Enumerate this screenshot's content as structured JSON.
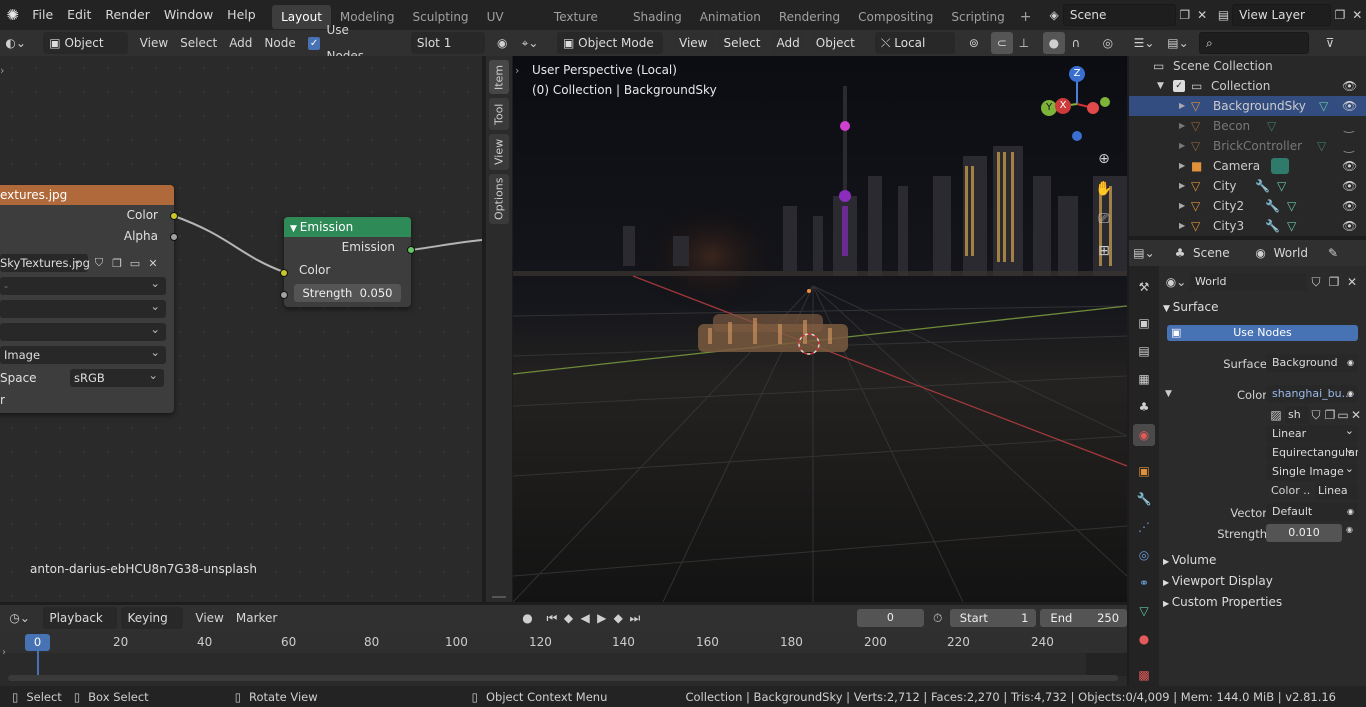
{
  "topbar": {
    "menus": [
      "File",
      "Edit",
      "Render",
      "Window",
      "Help"
    ],
    "workspaces": [
      "Layout",
      "Modeling",
      "Sculpting",
      "UV Editing",
      "Texture Paint",
      "Shading",
      "Animation",
      "Rendering",
      "Compositing",
      "Scripting"
    ],
    "active_workspace": "Layout",
    "add_tab": "+",
    "scene": "Scene",
    "view_layer": "View Layer"
  },
  "node_editor": {
    "header": {
      "object_mode": "Object",
      "menus": [
        "View",
        "Select",
        "Add",
        "Node"
      ],
      "use_nodes_label": "Use Nodes",
      "use_nodes_checked": true,
      "slot": "Slot 1"
    },
    "image_node": {
      "title": "extures.jpg",
      "out_color": "Color",
      "out_alpha": "Alpha",
      "image_name": "SkyTextures.jpg",
      "source": "Image",
      "color_space_label": "Space",
      "color_space": "sRGB",
      "trailing": "r"
    },
    "emission_node": {
      "title": "Emission",
      "out_emission": "Emission",
      "in_color": "Color",
      "strength_label": "Strength",
      "strength_value": "0.050"
    },
    "frame_label": "anton-darius-ebHCU8n7G38-unsplash",
    "side_tabs": [
      "Item",
      "Tool",
      "View",
      "Options"
    ]
  },
  "viewport": {
    "header": {
      "mode": "Object Mode",
      "menus": [
        "View",
        "Select",
        "Add",
        "Object"
      ],
      "orientation": "Local"
    },
    "overlay_title": "User Perspective (Local)",
    "overlay_sub": "(0) Collection | BackgroundSky",
    "gizmo": {
      "x": "X",
      "y": "Y",
      "z": "Z"
    }
  },
  "outliner": {
    "root": "Scene Collection",
    "collection": "Collection",
    "items": [
      {
        "name": "BackgroundSky",
        "dim": false
      },
      {
        "name": "Becon",
        "dim": true
      },
      {
        "name": "BrickController",
        "dim": true
      },
      {
        "name": "Camera",
        "dim": false
      },
      {
        "name": "City",
        "dim": false
      },
      {
        "name": "City2",
        "dim": false
      },
      {
        "name": "City3",
        "dim": false
      }
    ]
  },
  "properties": {
    "header": {
      "scene_tab": "Scene",
      "world_tab": "World"
    },
    "world_name": "World",
    "surface_section": "Surface",
    "use_nodes_btn": "Use Nodes",
    "surface_label": "Surface",
    "surface_value": "Background",
    "color_label": "Color",
    "color_value": "shanghai_bu...",
    "image_short": "sh",
    "interpolation": "Linear",
    "projection": "Equirectangular",
    "source": "Single Image",
    "colorspace_label": "Color ..",
    "colorspace_value": "Linea",
    "vector_label": "Vector",
    "vector_value": "Default",
    "strength_label": "Strength",
    "strength_value": "0.010",
    "collapsed": [
      "Volume",
      "Viewport Display",
      "Custom Properties"
    ]
  },
  "timeline": {
    "header": {
      "menus": [
        "Playback",
        "Keying",
        "View",
        "Marker"
      ],
      "current_frame": "0",
      "start_label": "Start",
      "start": "1",
      "end_label": "End",
      "end": "250"
    },
    "ticks": [
      "0",
      "20",
      "40",
      "60",
      "80",
      "100",
      "120",
      "140",
      "160",
      "180",
      "200",
      "220",
      "240"
    ]
  },
  "statusbar": {
    "select": "Select",
    "box_select": "Box Select",
    "rotate": "Rotate View",
    "context_menu": "Object Context Menu",
    "stats": "Collection | BackgroundSky | Verts:2,712 | Faces:2,270 | Tris:4,732 | Objects:0/4,009 | Mem: 144.0 MiB | v2.81.16"
  },
  "colors": {
    "accent_blue": "#4772b3",
    "emission_header": "#2e8b57",
    "image_header": "#b0693a",
    "socket_yellow": "#c7c729",
    "socket_gray": "#a1a1a1",
    "socket_green": "#63c763"
  }
}
